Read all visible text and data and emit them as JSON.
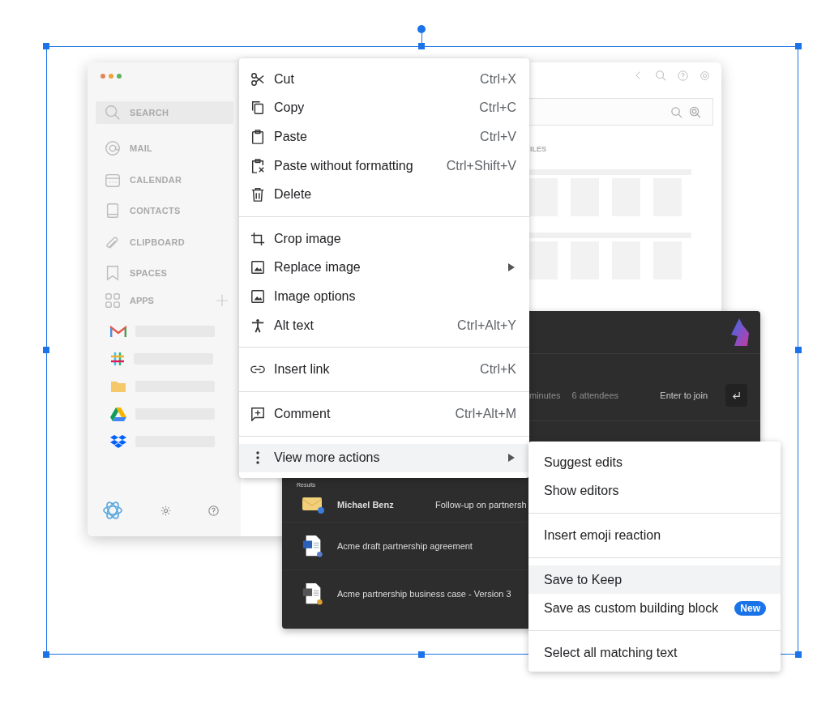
{
  "app": {
    "sidebar": {
      "items": [
        {
          "label": "SEARCH",
          "selected": true
        },
        {
          "label": "MAIL",
          "selected": false
        },
        {
          "label": "CALENDAR",
          "selected": false
        },
        {
          "label": "CONTACTS",
          "selected": false
        },
        {
          "label": "CLIPBOARD",
          "selected": false
        },
        {
          "label": "SPACES",
          "selected": false
        }
      ],
      "apps_heading": "APPS"
    },
    "main": {
      "section_label": "ILES"
    }
  },
  "dark_panel": {
    "meeting": {
      "duration": "minutes",
      "attendees": "6 attendees",
      "action": "Enter to join"
    },
    "results_heading": "Results",
    "results": [
      {
        "kind": "mail",
        "title": "Michael Benz",
        "subtitle": "Follow-up on partnersh"
      },
      {
        "kind": "word",
        "title": "Acme draft partnership agreement"
      },
      {
        "kind": "excel",
        "title": "Acme partnership business case - Version 3"
      }
    ]
  },
  "context_menu": {
    "groups": [
      [
        {
          "label": "Cut",
          "shortcut": "Ctrl+X",
          "has_submenu": false,
          "selected": false
        },
        {
          "label": "Copy",
          "shortcut": "Ctrl+C",
          "has_submenu": false,
          "selected": false
        },
        {
          "label": "Paste",
          "shortcut": "Ctrl+V",
          "has_submenu": false,
          "selected": false
        },
        {
          "label": "Paste without formatting",
          "shortcut": "Ctrl+Shift+V",
          "has_submenu": false,
          "selected": false
        },
        {
          "label": "Delete",
          "has_submenu": false,
          "selected": false
        }
      ],
      [
        {
          "label": "Crop image",
          "has_submenu": false,
          "selected": false
        },
        {
          "label": "Replace image",
          "has_submenu": true,
          "selected": false
        },
        {
          "label": "Image options",
          "has_submenu": false,
          "selected": false
        },
        {
          "label": "Alt text",
          "shortcut": "Ctrl+Alt+Y",
          "has_submenu": false,
          "selected": false
        }
      ],
      [
        {
          "label": "Insert link",
          "shortcut": "Ctrl+K",
          "has_submenu": false,
          "selected": false
        }
      ],
      [
        {
          "label": "Comment",
          "shortcut": "Ctrl+Alt+M",
          "has_submenu": false,
          "selected": false
        }
      ],
      [
        {
          "label": "View more actions",
          "has_submenu": true,
          "selected": true
        }
      ]
    ]
  },
  "submenu": {
    "groups": [
      [
        {
          "label": "Suggest edits",
          "selected": false
        },
        {
          "label": "Show editors",
          "selected": false
        }
      ],
      [
        {
          "label": "Insert emoji reaction",
          "selected": false
        }
      ],
      [
        {
          "label": "Save to Keep",
          "selected": true
        },
        {
          "label": "Save as custom building block",
          "badge": "New",
          "selected": false
        }
      ],
      [
        {
          "label": "Select all matching text",
          "selected": false
        }
      ]
    ]
  }
}
